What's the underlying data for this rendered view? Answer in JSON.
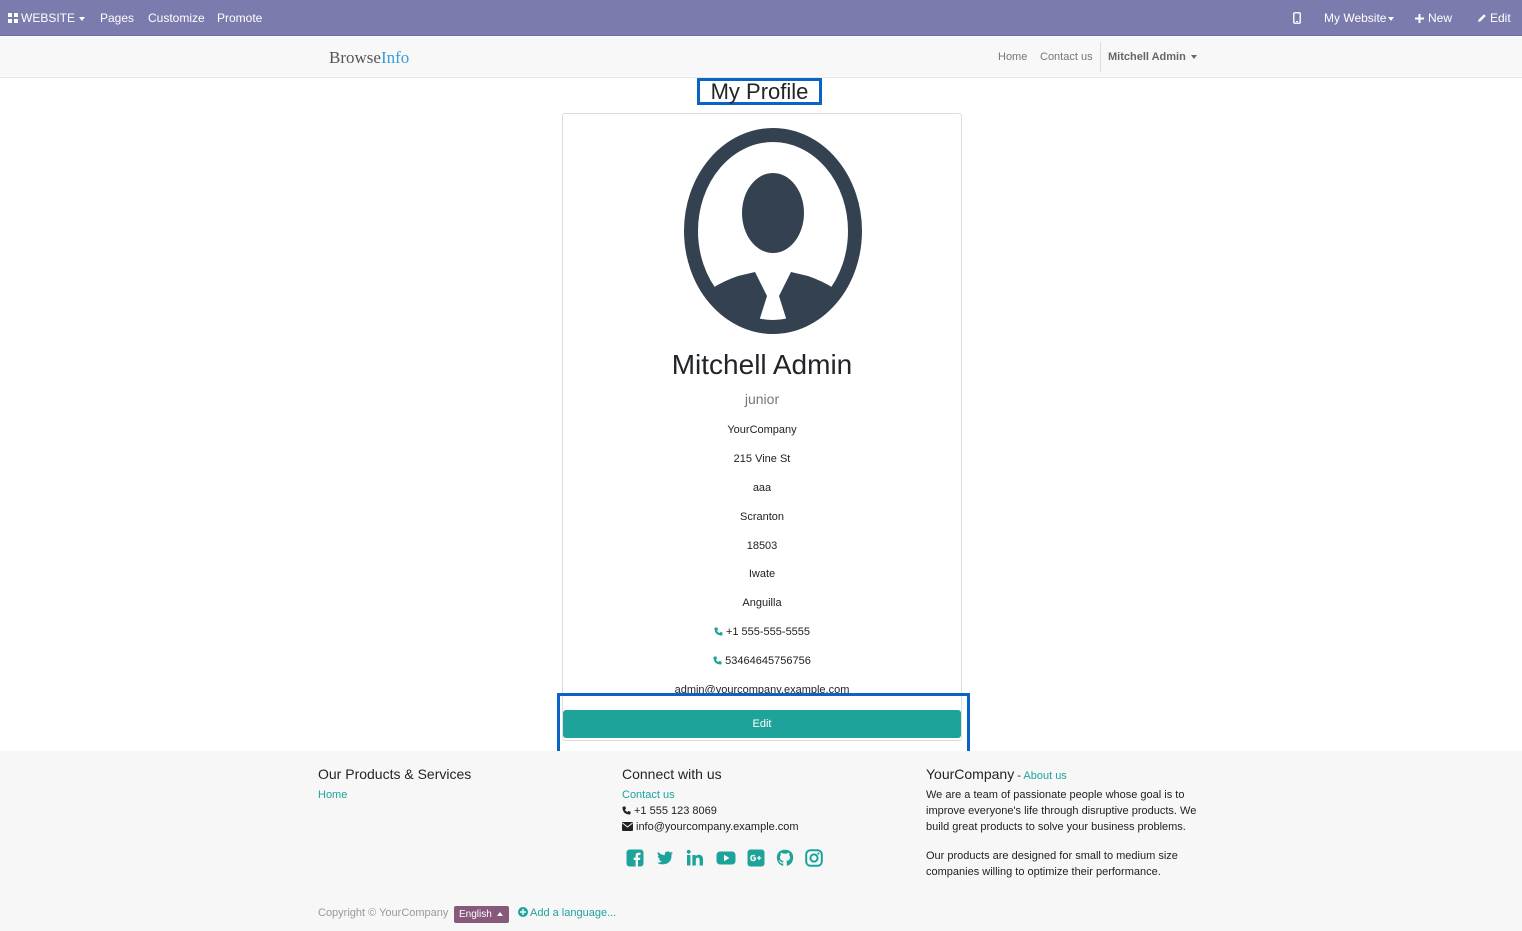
{
  "topbar": {
    "website_label": "WEBSITE",
    "pages_label": "Pages",
    "customize_label": "Customize",
    "promote_label": "Promote",
    "my_website_label": "My Website",
    "new_label": "New",
    "edit_label": "Edit",
    "bg_color": "#7c7bad"
  },
  "navbar": {
    "brand_part1": "Browse",
    "brand_part2": "Info",
    "links": [
      "Home",
      "Contact us"
    ],
    "user_label": "Mitchell Admin"
  },
  "page": {
    "title": "My Profile"
  },
  "profile": {
    "name": "Mitchell Admin",
    "job": "junior",
    "company": "YourCompany",
    "street": "215 Vine St",
    "street2": "aaa",
    "city": "Scranton",
    "zip": "18503",
    "state": "Iwate",
    "country": "Anguilla",
    "phone": "+1 555-555-5555",
    "mobile": "53464645756756",
    "email": "admin@yourcompany.example.com",
    "edit_label": "Edit",
    "accent_color": "#1ea39b"
  },
  "footer": {
    "col1_title": "Our Products & Services",
    "col1_link": "Home",
    "col2_title": "Connect with us",
    "col2_link": "Contact us",
    "col2_phone": "+1 555 123 8069",
    "col2_email": "info@yourcompany.example.com",
    "col3_title": "YourCompany",
    "col3_sep": " - ",
    "col3_link": "About us",
    "col3_text1": "We are a team of passionate people whose goal is to improve everyone's life through disruptive products. We build great products to solve your business problems.",
    "col3_text2": "Our products are designed for small to medium size companies willing to optimize their performance.",
    "social_icons": [
      "facebook-icon",
      "twitter-icon",
      "linkedin-icon",
      "youtube-icon",
      "google-plus-icon",
      "github-icon",
      "instagram-icon"
    ],
    "copyright": "Copyright © YourCompany",
    "language": "English",
    "add_language": "Add a language..."
  }
}
